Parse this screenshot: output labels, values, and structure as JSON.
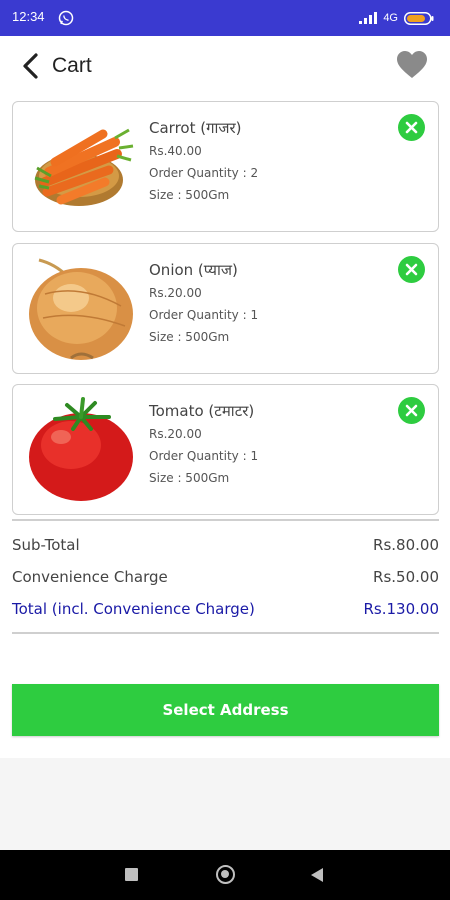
{
  "status_bar": {
    "time": "12:34",
    "network": "4G",
    "icons": [
      "whatsapp-icon",
      "signal-icon",
      "battery-icon"
    ]
  },
  "header": {
    "title": "Cart",
    "back_icon": "chevron-left-icon",
    "favorite_icon": "heart-icon"
  },
  "cart_items": [
    {
      "name": "Carrot (गाजर)",
      "price": "Rs.40.00",
      "quantity": "Order Quantity : 2",
      "size": "Size : 500Gm",
      "image": "carrot-image"
    },
    {
      "name": "Onion (प्याज)",
      "price": "Rs.20.00",
      "quantity": "Order Quantity : 1",
      "size": "Size : 500Gm",
      "image": "onion-image"
    },
    {
      "name": "Tomato (टमाटर)",
      "price": "Rs.20.00",
      "quantity": "Order Quantity : 1",
      "size": "Size : 500Gm",
      "image": "tomato-image"
    }
  ],
  "summary": {
    "subtotal_label": "Sub-Total",
    "subtotal_value": "Rs.80.00",
    "convenience_label": "Convenience Charge",
    "convenience_value": "Rs.50.00",
    "total_label": "Total (incl. Convenience Charge)",
    "total_value": "Rs.130.00"
  },
  "actions": {
    "select_address_label": "Select Address"
  },
  "colors": {
    "status_bar": "#3a3ad0",
    "accent_green": "#2ecc40",
    "total_blue": "#1a1aa6"
  }
}
